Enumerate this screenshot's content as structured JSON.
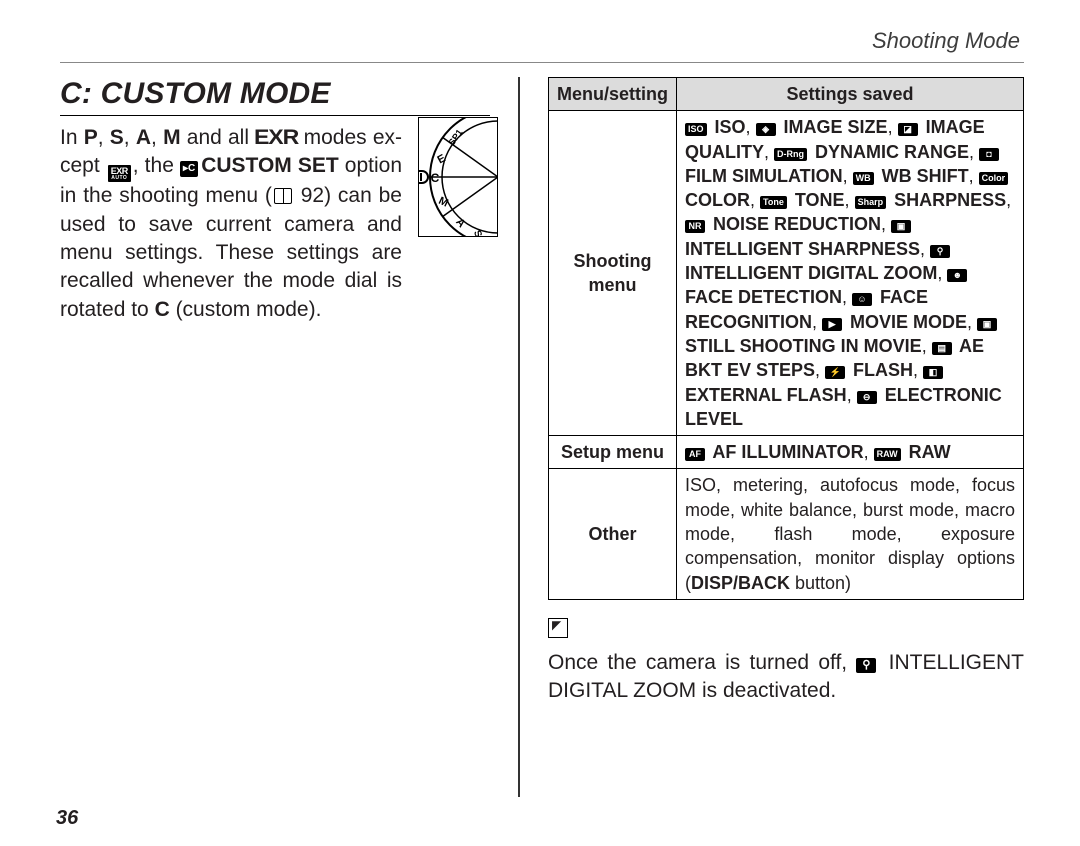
{
  "header": {
    "running_title": "Shooting Mode"
  },
  "page_number": "36",
  "title": "C: CUSTOM MODE",
  "paragraph": {
    "line1_pre": "In ",
    "P": "P",
    "S": "S",
    "A": "A",
    "M": "M",
    "line1_mid1": ", ",
    "line1_mid2": " and all ",
    "exr_text": "EXR",
    "line1_post": " modes ex­cept ",
    "exr_auto_top": "EXR",
    "exr_auto_bot": "AUTO",
    "line2_pre": ", the ",
    "custom_set_icon": "▸C",
    "custom_set_label": "CUSTOM SET",
    "line2_post": " option in the shooting menu (",
    "page_ref": " 92",
    "line3": ") can be used to save current camera and menu settings.  These settings are recalled whenever the mode dial is rotated to ",
    "C": "C",
    "line4": " (custom mode)."
  },
  "table": {
    "head": {
      "menu": "Menu/setting",
      "saved": "Settings saved"
    },
    "rows": {
      "shooting": {
        "key": "Shooting menu",
        "segments": [
          {
            "icon": "ISO",
            "bold": " ISO"
          },
          {
            "plain": ", "
          },
          {
            "icon": "◈",
            "bold": " IMAGE SIZE"
          },
          {
            "plain": ", "
          },
          {
            "icon": "◪",
            "bold": " IMAGE QUAL­ITY"
          },
          {
            "plain": ", "
          },
          {
            "icon": "D-Rng",
            "bold": " DYNAMIC RANGE"
          },
          {
            "plain": ", "
          },
          {
            "icon": "◘",
            "bold": " FILM SIMULA­TION"
          },
          {
            "plain": ", "
          },
          {
            "icon": "WB",
            "bold": " WB SHIFT"
          },
          {
            "plain": ", "
          },
          {
            "icon": "Color",
            "bold": " COLOR"
          },
          {
            "plain": ", "
          },
          {
            "icon": "Tone",
            "bold": " TONE"
          },
          {
            "plain": ", "
          },
          {
            "icon": "Sharp",
            "bold": " SHARPNESS"
          },
          {
            "plain": ", "
          },
          {
            "icon": "NR",
            "bold": " NOISE REDUCTION"
          },
          {
            "plain": ", "
          },
          {
            "icon": "▣",
            "bold": " INTELLIGENT SHARPNESS"
          },
          {
            "plain": ", "
          },
          {
            "icon": "⚲",
            "bold": " INTELLI­GENT DIGITAL ZOOM"
          },
          {
            "plain": ", "
          },
          {
            "icon": "☻",
            "bold": " FACE DETECTION"
          },
          {
            "plain": ", "
          },
          {
            "icon": "☺",
            "bold": " FACE RECOGNITION"
          },
          {
            "plain": ", "
          },
          {
            "icon": "▶",
            "bold": " MOVIE MODE"
          },
          {
            "plain": ", "
          },
          {
            "icon": "▣",
            "bold": " STILL SHOOTING IN MOVIE"
          },
          {
            "plain": ", "
          },
          {
            "icon": "▤",
            "bold": " AE BKT EV STEPS"
          },
          {
            "plain": ", "
          },
          {
            "icon": "⚡",
            "bold": " FLASH"
          },
          {
            "plain": ", "
          },
          {
            "icon": "◧",
            "bold": " EXTERNAL FLASH"
          },
          {
            "plain": ", "
          },
          {
            "icon": "⊖",
            "bold": " ELECTRONIC LEVEL"
          }
        ]
      },
      "setup": {
        "key": "Setup menu",
        "segments": [
          {
            "icon": "AF",
            "bold": " AF ILLUMINATOR"
          },
          {
            "plain": ", "
          },
          {
            "icon": "RAW",
            "bold": " RAW"
          }
        ]
      },
      "other": {
        "key": "Other",
        "text_pre": "ISO, metering, autofocus mode, focus mode, white balance, burst mode, macro mode, flash mode, exposure compensation, monitor dis­play options (",
        "disp_back": "DISP/BACK",
        "text_post": " button)"
      }
    }
  },
  "note": {
    "pre": "Once the camera is turned off, ",
    "icon": "⚲",
    "bold": " INTELLIGENT DIGI­TAL ZOOM",
    "post": " is deactivated."
  }
}
